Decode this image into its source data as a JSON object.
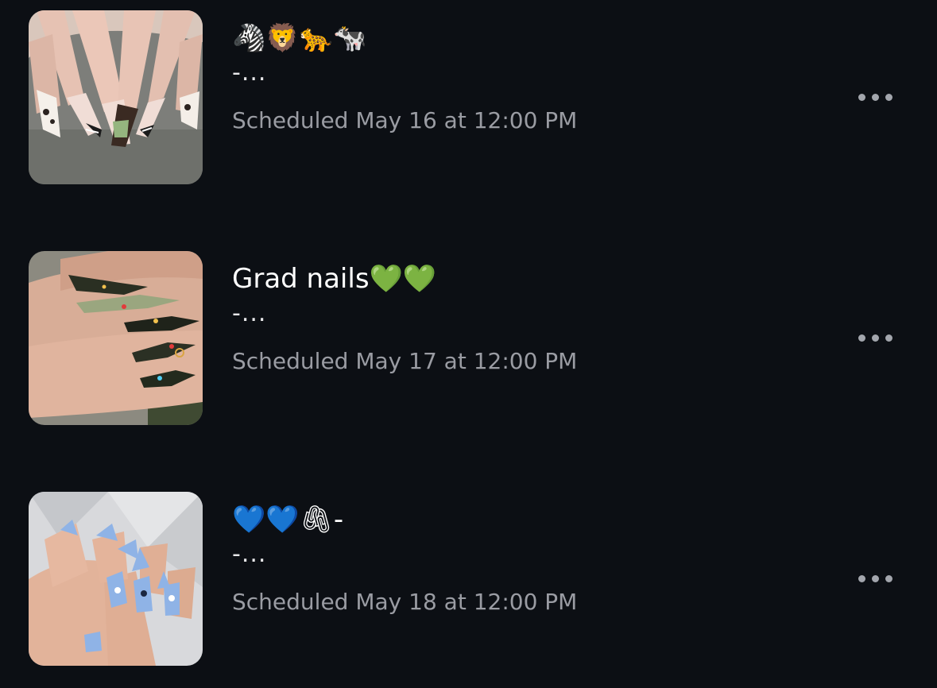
{
  "posts": [
    {
      "caption": "🦓🦁🐆🐄",
      "caption_more": "-...",
      "schedule": "Scheduled May 16 at 12:00 PM",
      "thumbnail": "animal-print-french-nails"
    },
    {
      "caption": "Grad nails💚💚",
      "caption_more": "-...",
      "schedule": "Scheduled May 17 at 12:00 PM",
      "thumbnail": "clear-green-jeweled-nails"
    },
    {
      "caption": "💙💙🖇-",
      "caption_more": "-...",
      "schedule": "Scheduled May 18 at 12:00 PM",
      "thumbnail": "blue-floral-stiletto-nails"
    }
  ],
  "colors": {
    "background": "#0c0f14",
    "primary_text": "#ffffff",
    "secondary_text": "#9a9ca3",
    "more_dots": "#a3a6ad"
  },
  "icons": {
    "more": "ellipsis-horizontal-icon"
  }
}
